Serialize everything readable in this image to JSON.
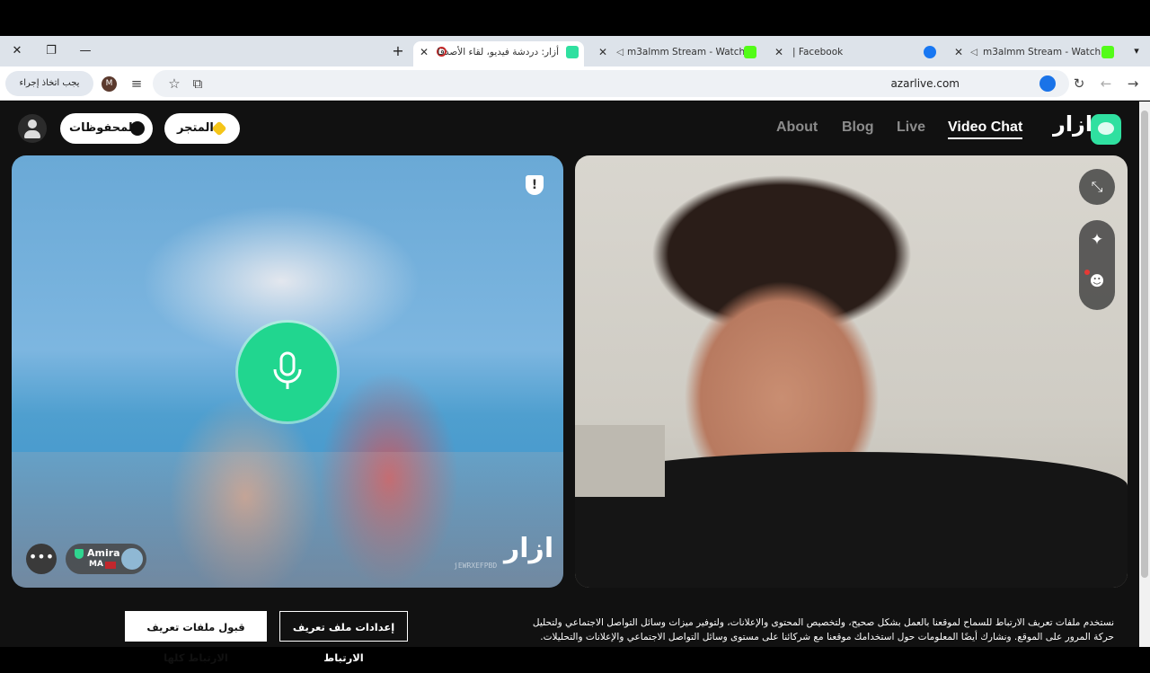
{
  "browser": {
    "tabs": [
      {
        "title": "m3almm Stream - Watch Li",
        "favicon_color": "#53fc18"
      },
      {
        "title": "| Facebook",
        "favicon_color": "#1877f2"
      },
      {
        "title": "m3almm Stream - Watch Li",
        "favicon_color": "#53fc18"
      },
      {
        "title": "أزار: دردشة فيديو، لقاء الأصدقا",
        "favicon_color": "#2fe0a0"
      }
    ],
    "new_tab": "+",
    "close_symbol": "✕",
    "window_close": "✕",
    "window_restore": "❐",
    "window_minimize": "—",
    "url": "azarlive.com",
    "action_button": "يجب اتخاذ إجراء",
    "profile_initial": "M"
  },
  "site": {
    "logo": "ازار",
    "nav": {
      "video_chat": "Video Chat",
      "live": "Live",
      "blog": "Blog",
      "about": "About"
    },
    "store_label": "المتجر",
    "saved_label": "المحفوظات"
  },
  "left_video": {
    "user_name": "Amira",
    "country_code": "MA",
    "watermark_id": "jEWRXEFPBD",
    "watermark_logo": "ازار",
    "shield_symbol": "!",
    "chat_symbol": "•••"
  },
  "right_video": {
    "expand_symbol": "⤡",
    "sparkle_symbol": "✦",
    "face_symbol": "☻"
  },
  "cookie": {
    "text_line1": "نستخدم ملفات تعريف الارتباط للسماح لموقعنا بالعمل بشكل صحيح، ولتخصيص المحتوى والإعلانات، ولتوفير ميزات وسائل التواصل الاجتماعي ولتحليل",
    "text_line2": "حركة المرور على الموقع. ونشارك أيضًا المعلومات حول استخدامك موقعنا مع شركائنا على مستوى وسائل التواصل الاجتماعي والإعلانات والتحليلات.",
    "settings_button": "إعدادات ملف تعريف الارتباط",
    "accept_button": "قبول ملفات تعريف الارتباط كلها"
  }
}
